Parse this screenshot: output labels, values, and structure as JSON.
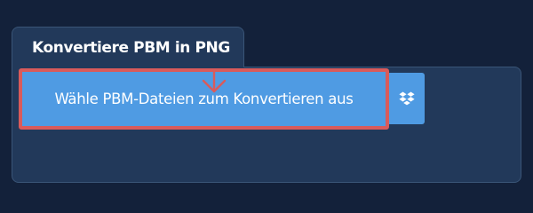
{
  "converter": {
    "title": "Konvertiere PBM in PNG",
    "select_button_label": "Wähle PBM-Dateien zum Konvertieren aus",
    "dropbox_icon": "dropbox-icon"
  },
  "colors": {
    "page_background": "#13213a",
    "card_background": "#22395a",
    "button_background": "#4f9be3",
    "highlight_border": "#d95b5b",
    "arrow": "#d95b5b"
  }
}
